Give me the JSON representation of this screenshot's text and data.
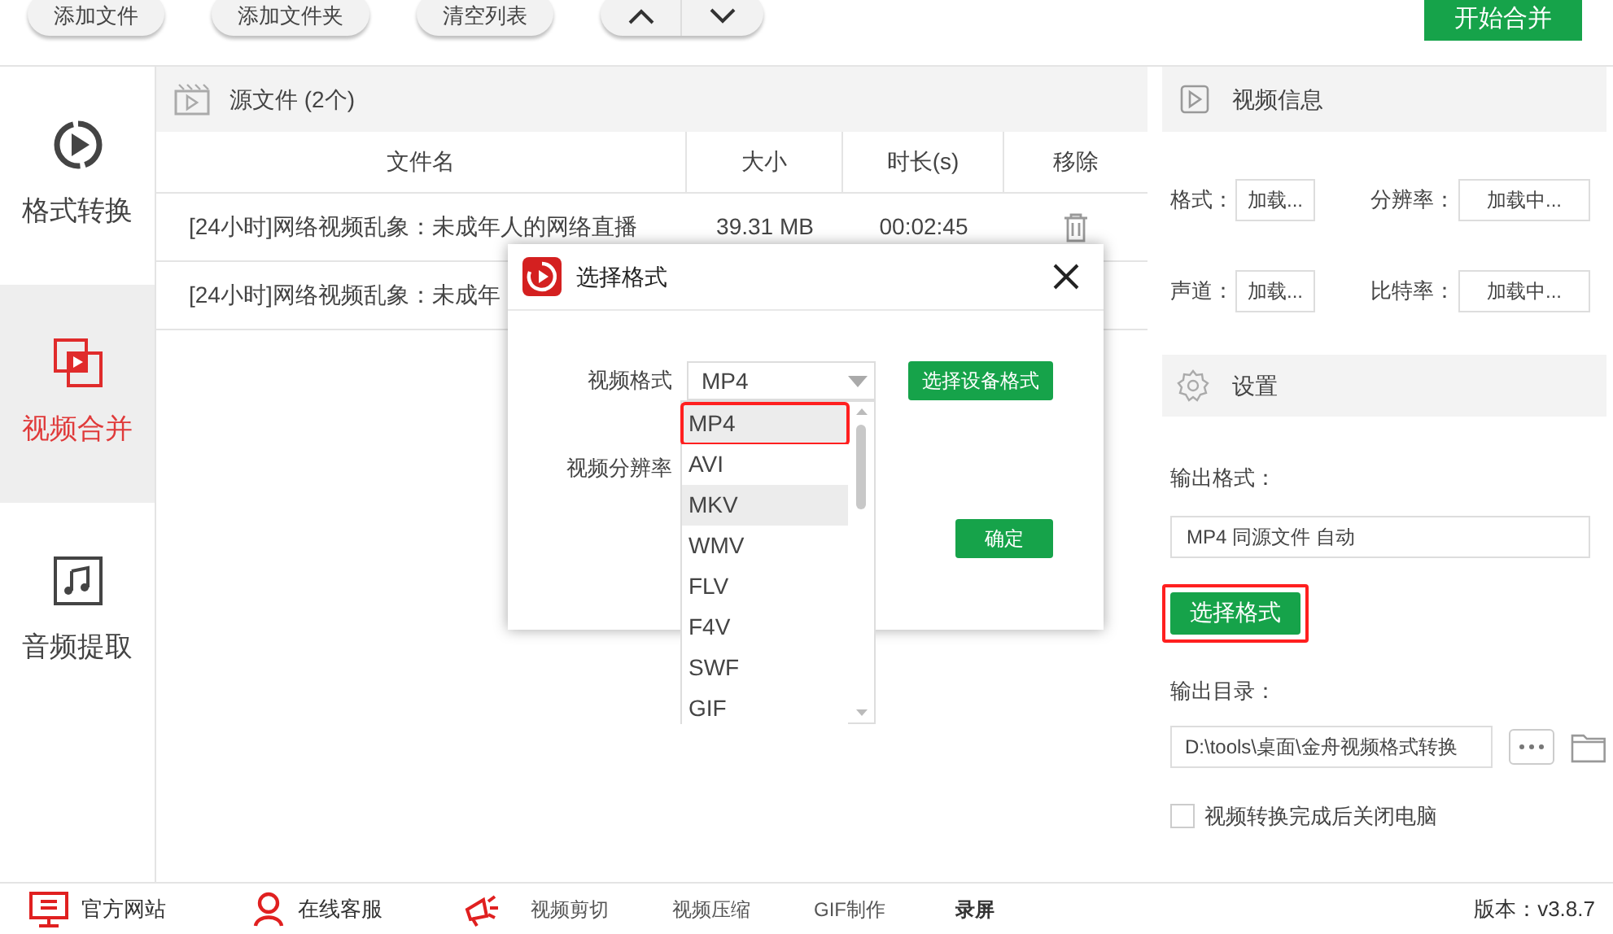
{
  "toolbar": {
    "buttons": [
      "添加文件",
      "添加文件夹",
      "清空列表"
    ],
    "start_button": "开始合并"
  },
  "sidebar": {
    "items": [
      {
        "label": "格式转换",
        "kind": "convert",
        "selected": false
      },
      {
        "label": "视频合并",
        "kind": "merge",
        "selected": true
      },
      {
        "label": "音频提取",
        "kind": "audio",
        "selected": false
      }
    ]
  },
  "file_list": {
    "title": "源文件 (2个)",
    "columns": [
      "文件名",
      "大小",
      "时长(s)",
      "移除"
    ],
    "rows": [
      {
        "name": "[24小时]网络视频乱象：未成年人的网络直播",
        "size": "39.31 MB",
        "duration": "00:02:45"
      },
      {
        "name": "[24小时]网络视频乱象：未成年"
      }
    ]
  },
  "video_info": {
    "title": "视频信息",
    "fields": [
      {
        "label": "格式：",
        "value": "加载..."
      },
      {
        "label": "分辨率：",
        "value": "加载中..."
      },
      {
        "label": "声道：",
        "value": "加载..."
      },
      {
        "label": "比特率：",
        "value": "加载中..."
      }
    ]
  },
  "settings": {
    "title": "设置",
    "output_format_label": "输出格式：",
    "output_format": "MP4 同源文件 自动",
    "choose_format_button": "选择格式",
    "choose_format_highlighted": true,
    "output_dir_label": "输出目录：",
    "output_dir": "D:\\tools\\桌面\\金舟视频格式转换",
    "shutdown": {
      "label": "视频转换完成后关闭电脑",
      "checked": false
    }
  },
  "dialog": {
    "title": "选择格式",
    "format_label": "视频格式",
    "format_value": "MP4",
    "device_button": "选择设备格式",
    "resolution_label": "视频分辨率",
    "ok_button": "确定",
    "options": [
      {
        "label": "MP4",
        "selected": true,
        "hovered": false
      },
      {
        "label": "AVI",
        "selected": false,
        "hovered": false
      },
      {
        "label": "MKV",
        "selected": false,
        "hovered": true
      },
      {
        "label": "WMV",
        "selected": false,
        "hovered": false
      },
      {
        "label": "FLV",
        "selected": false,
        "hovered": false
      },
      {
        "label": "F4V",
        "selected": false,
        "hovered": false
      },
      {
        "label": "SWF",
        "selected": false,
        "hovered": false
      },
      {
        "label": "GIF",
        "selected": false,
        "hovered": false
      }
    ]
  },
  "footer": {
    "links": [
      {
        "label": "官方网站",
        "kind": "website"
      },
      {
        "label": "在线客服",
        "kind": "support"
      }
    ],
    "tools": [
      {
        "label": "视频剪切",
        "bold": false
      },
      {
        "label": "视频压缩",
        "bold": false
      },
      {
        "label": "GIF制作",
        "bold": false
      },
      {
        "label": "录屏",
        "bold": true
      }
    ],
    "version": "版本：v3.8.7"
  }
}
